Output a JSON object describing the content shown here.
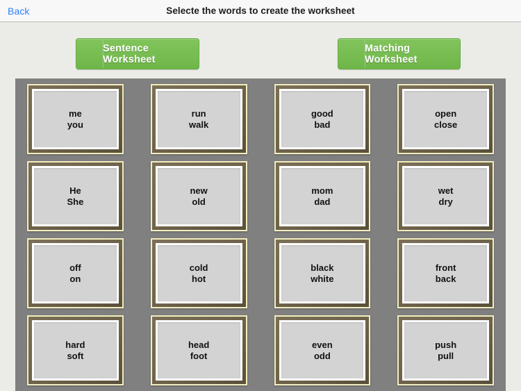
{
  "header": {
    "back_label": "Back",
    "title": "Selecte the words to create the worksheet"
  },
  "actions": {
    "sentence_worksheet_label": "Sentence Worksheet",
    "matching_worksheet_label": "Matching Worksheet"
  },
  "colors": {
    "page_background": "#ebebe8",
    "header_background": "#f8f8f8",
    "back_link": "#2d7ff9",
    "button_green": "#79be53",
    "panel_gray": "#808080",
    "card_face": "#d3d3d3",
    "card_frame_dark": "#6d6249",
    "card_frame_gold": "#f2eec0"
  },
  "cards": {
    "rows": [
      [
        {
          "word_top": "me",
          "word_bottom": "you"
        },
        {
          "word_top": "run",
          "word_bottom": "walk"
        },
        {
          "word_top": "good",
          "word_bottom": "bad"
        },
        {
          "word_top": "open",
          "word_bottom": "close"
        }
      ],
      [
        {
          "word_top": "He",
          "word_bottom": "She"
        },
        {
          "word_top": "new",
          "word_bottom": "old"
        },
        {
          "word_top": "mom",
          "word_bottom": "dad"
        },
        {
          "word_top": "wet",
          "word_bottom": "dry"
        }
      ],
      [
        {
          "word_top": "off",
          "word_bottom": "on"
        },
        {
          "word_top": "cold",
          "word_bottom": "hot"
        },
        {
          "word_top": "black",
          "word_bottom": "white"
        },
        {
          "word_top": "front",
          "word_bottom": "back"
        }
      ],
      [
        {
          "word_top": "hard",
          "word_bottom": "soft"
        },
        {
          "word_top": "head",
          "word_bottom": "foot"
        },
        {
          "word_top": "even",
          "word_bottom": "odd"
        },
        {
          "word_top": "push",
          "word_bottom": "pull"
        }
      ]
    ]
  }
}
